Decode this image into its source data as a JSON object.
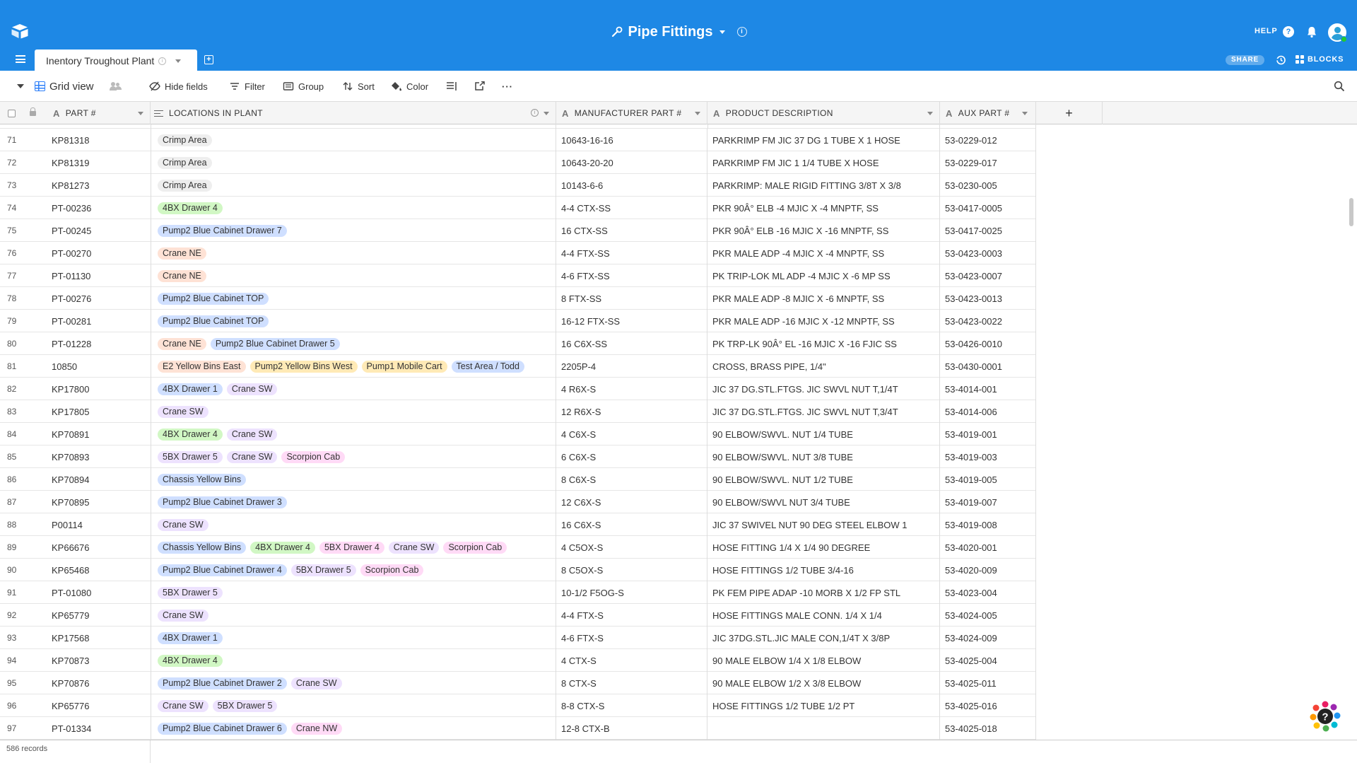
{
  "app": {
    "base_title": "Pipe Fittings",
    "help_label": "HELP",
    "help_icon": "?",
    "share_label": "SHARE",
    "blocks_label": "BLOCKS",
    "table_tab": "Inentory Troughout Plant",
    "info_glyph": "i",
    "add_glyph": "+",
    "brand_color": "#1e88e5"
  },
  "toolbar": {
    "view_name": "Grid view",
    "hide_fields": "Hide fields",
    "filter": "Filter",
    "group": "Group",
    "sort": "Sort",
    "color": "Color",
    "more": "···"
  },
  "columns": {
    "part": "PART #",
    "locations": "LOCATIONS IN PLANT",
    "manufacturer": "MANUFACTURER PART #",
    "description": "PRODUCT DESCRIPTION",
    "aux": "AUX PART #",
    "type_glyph": "A",
    "add_field": "+"
  },
  "location_colors": {
    "Crimp Area": "#eeeeee",
    "4BX Drawer 4": "#d1f7c4",
    "4BX Drawer 1": "#cfdfff",
    "Pump2 Blue Cabinet Drawer 7": "#cfdfff",
    "Pump2 Blue Cabinet Drawer 6": "#cfdfff",
    "Pump2 Blue Cabinet Drawer 5": "#cfdfff",
    "Pump2 Blue Cabinet Drawer 4": "#cfdfff",
    "Pump2 Blue Cabinet Drawer 3": "#cfdfff",
    "Pump2 Blue Cabinet Drawer 2": "#cfdfff",
    "Pump2 Blue Cabinet TOP": "#cfdfff",
    "Crane NE": "#fee2d5",
    "Crane NW": "#ffdaf6",
    "Crane SW": "#ede2fe",
    "5BX Drawer 5": "#ede2fe",
    "5BX Drawer 4": "#ffdaf6",
    "Scorpion Cab": "#ffdaf6",
    "E2 Yellow Bins East": "#fee2d5",
    "Pump2 Yellow Bins West": "#ffeab6",
    "Pump1 Mobile Cart": "#ffeab6",
    "Test Area / Todd": "#cfdfff",
    "Chassis Yellow Bins": "#cfdfff"
  },
  "rows": [
    {
      "n": "71",
      "part": "KP81318",
      "loc": [
        "Crimp Area"
      ],
      "mfr": "10643-16-16",
      "desc": "PARKRIMP FM JIC 37 DG 1 TUBE X 1 HOSE",
      "aux": "53-0229-012"
    },
    {
      "n": "72",
      "part": "KP81319",
      "loc": [
        "Crimp Area"
      ],
      "mfr": "10643-20-20",
      "desc": "PARKRIMP FM JIC 1 1/4 TUBE X HOSE",
      "aux": "53-0229-017"
    },
    {
      "n": "73",
      "part": "KP81273",
      "loc": [
        "Crimp Area"
      ],
      "mfr": "10143-6-6",
      "desc": "PARKRIMP: MALE RIGID FITTING 3/8T X 3/8",
      "aux": "53-0230-005"
    },
    {
      "n": "74",
      "part": "PT-00236",
      "loc": [
        "4BX Drawer 4"
      ],
      "mfr": "4-4 CTX-SS",
      "desc": "PKR 90Â° ELB -4 MJIC X -4 MNPTF, SS",
      "aux": "53-0417-0005"
    },
    {
      "n": "75",
      "part": "PT-00245",
      "loc": [
        "Pump2 Blue Cabinet Drawer 7"
      ],
      "mfr": "16 CTX-SS",
      "desc": "PKR 90Â° ELB -16 MJIC X -16 MNPTF, SS",
      "aux": "53-0417-0025"
    },
    {
      "n": "76",
      "part": "PT-00270",
      "loc": [
        "Crane NE"
      ],
      "mfr": "4-4 FTX-SS",
      "desc": "PKR MALE ADP -4 MJIC X -4 MNPTF, SS",
      "aux": "53-0423-0003"
    },
    {
      "n": "77",
      "part": "PT-01130",
      "loc": [
        "Crane NE"
      ],
      "mfr": "4-6 FTX-SS",
      "desc": "PK TRIP-LOK ML ADP -4 MJIC X -6 MP SS",
      "aux": "53-0423-0007"
    },
    {
      "n": "78",
      "part": "PT-00276",
      "loc": [
        "Pump2 Blue Cabinet TOP"
      ],
      "mfr": "8 FTX-SS",
      "desc": "PKR MALE ADP -8 MJIC X -6 MNPTF, SS",
      "aux": "53-0423-0013"
    },
    {
      "n": "79",
      "part": "PT-00281",
      "loc": [
        "Pump2 Blue Cabinet TOP"
      ],
      "mfr": "16-12 FTX-SS",
      "desc": "PKR MALE ADP -16 MJIC X -12 MNPTF, SS",
      "aux": "53-0423-0022"
    },
    {
      "n": "80",
      "part": "PT-01228",
      "loc": [
        "Crane NE",
        "Pump2 Blue Cabinet Drawer 5"
      ],
      "mfr": "16 C6X-SS",
      "desc": "PK TRP-LK 90Â° EL -16 MJIC X -16 FJIC SS",
      "aux": "53-0426-0010"
    },
    {
      "n": "81",
      "part": "10850",
      "loc": [
        "E2 Yellow Bins East",
        "Pump2 Yellow Bins West",
        "Pump1 Mobile Cart",
        "Test Area / Todd"
      ],
      "mfr": "2205P-4",
      "desc": "CROSS, BRASS PIPE, 1/4\"",
      "aux": "53-0430-0001"
    },
    {
      "n": "82",
      "part": "KP17800",
      "loc": [
        "4BX Drawer 1",
        "Crane SW"
      ],
      "mfr": "4 R6X-S",
      "desc": "JIC 37 DG.STL.FTGS. JIC SWVL NUT T,1/4T",
      "aux": "53-4014-001"
    },
    {
      "n": "83",
      "part": "KP17805",
      "loc": [
        "Crane SW"
      ],
      "mfr": "12 R6X-S",
      "desc": "JIC 37 DG.STL.FTGS. JIC SWVL NUT T,3/4T",
      "aux": "53-4014-006"
    },
    {
      "n": "84",
      "part": "KP70891",
      "loc": [
        "4BX Drawer 4",
        "Crane SW"
      ],
      "mfr": "4 C6X-S",
      "desc": "90 ELBOW/SWVL. NUT 1/4 TUBE",
      "aux": "53-4019-001"
    },
    {
      "n": "85",
      "part": "KP70893",
      "loc": [
        "5BX Drawer 5",
        "Crane SW",
        "Scorpion Cab"
      ],
      "mfr": "6 C6X-S",
      "desc": "90 ELBOW/SWVL. NUT 3/8 TUBE",
      "aux": "53-4019-003"
    },
    {
      "n": "86",
      "part": "KP70894",
      "loc": [
        "Chassis Yellow Bins"
      ],
      "mfr": "8 C6X-S",
      "desc": "90 ELBOW/SWVL. NUT 1/2 TUBE",
      "aux": "53-4019-005"
    },
    {
      "n": "87",
      "part": "KP70895",
      "loc": [
        "Pump2 Blue Cabinet Drawer 3"
      ],
      "mfr": "12 C6X-S",
      "desc": "90 ELBOW/SWVL NUT 3/4 TUBE",
      "aux": "53-4019-007"
    },
    {
      "n": "88",
      "part": "P00114",
      "loc": [
        "Crane SW"
      ],
      "mfr": "16 C6X-S",
      "desc": "JIC 37 SWIVEL NUT 90 DEG STEEL ELBOW 1",
      "aux": "53-4019-008"
    },
    {
      "n": "89",
      "part": "KP66676",
      "loc": [
        "Chassis Yellow Bins",
        "4BX Drawer 4",
        "5BX Drawer 4",
        "Crane SW",
        "Scorpion Cab"
      ],
      "mfr": "4 C5OX-S",
      "desc": "HOSE FITTING 1/4 X 1/4 90 DEGREE",
      "aux": "53-4020-001"
    },
    {
      "n": "90",
      "part": "KP65468",
      "loc": [
        "Pump2 Blue Cabinet Drawer 4",
        "5BX Drawer 5",
        "Scorpion Cab"
      ],
      "mfr": "8 C5OX-S",
      "desc": "HOSE FITTINGS 1/2 TUBE 3/4-16",
      "aux": "53-4020-009"
    },
    {
      "n": "91",
      "part": "PT-01080",
      "loc": [
        "5BX Drawer 5"
      ],
      "mfr": "10-1/2 F5OG-S",
      "desc": "PK FEM PIPE ADAP -10 MORB X 1/2 FP STL",
      "aux": "53-4023-004"
    },
    {
      "n": "92",
      "part": "KP65779",
      "loc": [
        "Crane SW"
      ],
      "mfr": "4-4 FTX-S",
      "desc": "HOSE FITTINGS MALE CONN. 1/4 X 1/4",
      "aux": "53-4024-005"
    },
    {
      "n": "93",
      "part": "KP17568",
      "loc": [
        "4BX Drawer 1"
      ],
      "mfr": "4-6 FTX-S",
      "desc": "JIC 37DG.STL.JIC MALE CON,1/4T X 3/8P",
      "aux": "53-4024-009"
    },
    {
      "n": "94",
      "part": "KP70873",
      "loc": [
        "4BX Drawer 4"
      ],
      "mfr": "4 CTX-S",
      "desc": "90 MALE ELBOW 1/4 X 1/8 ELBOW",
      "aux": "53-4025-004"
    },
    {
      "n": "95",
      "part": "KP70876",
      "loc": [
        "Pump2 Blue Cabinet Drawer 2",
        "Crane SW"
      ],
      "mfr": "8 CTX-S",
      "desc": "90 MALE ELBOW 1/2 X 3/8 ELBOW",
      "aux": "53-4025-011"
    },
    {
      "n": "96",
      "part": "KP65776",
      "loc": [
        "Crane SW",
        "5BX Drawer 5"
      ],
      "mfr": "8-8 CTX-S",
      "desc": "HOSE FITTINGS 1/2 TUBE 1/2 PT",
      "aux": "53-4025-016"
    },
    {
      "n": "97",
      "part": "PT-01334",
      "loc": [
        "Pump2 Blue Cabinet Drawer 6",
        "Crane NW"
      ],
      "mfr": "12-8 CTX-B",
      "desc": "",
      "aux": "53-4025-018"
    }
  ],
  "footer": {
    "records": "586 records"
  }
}
